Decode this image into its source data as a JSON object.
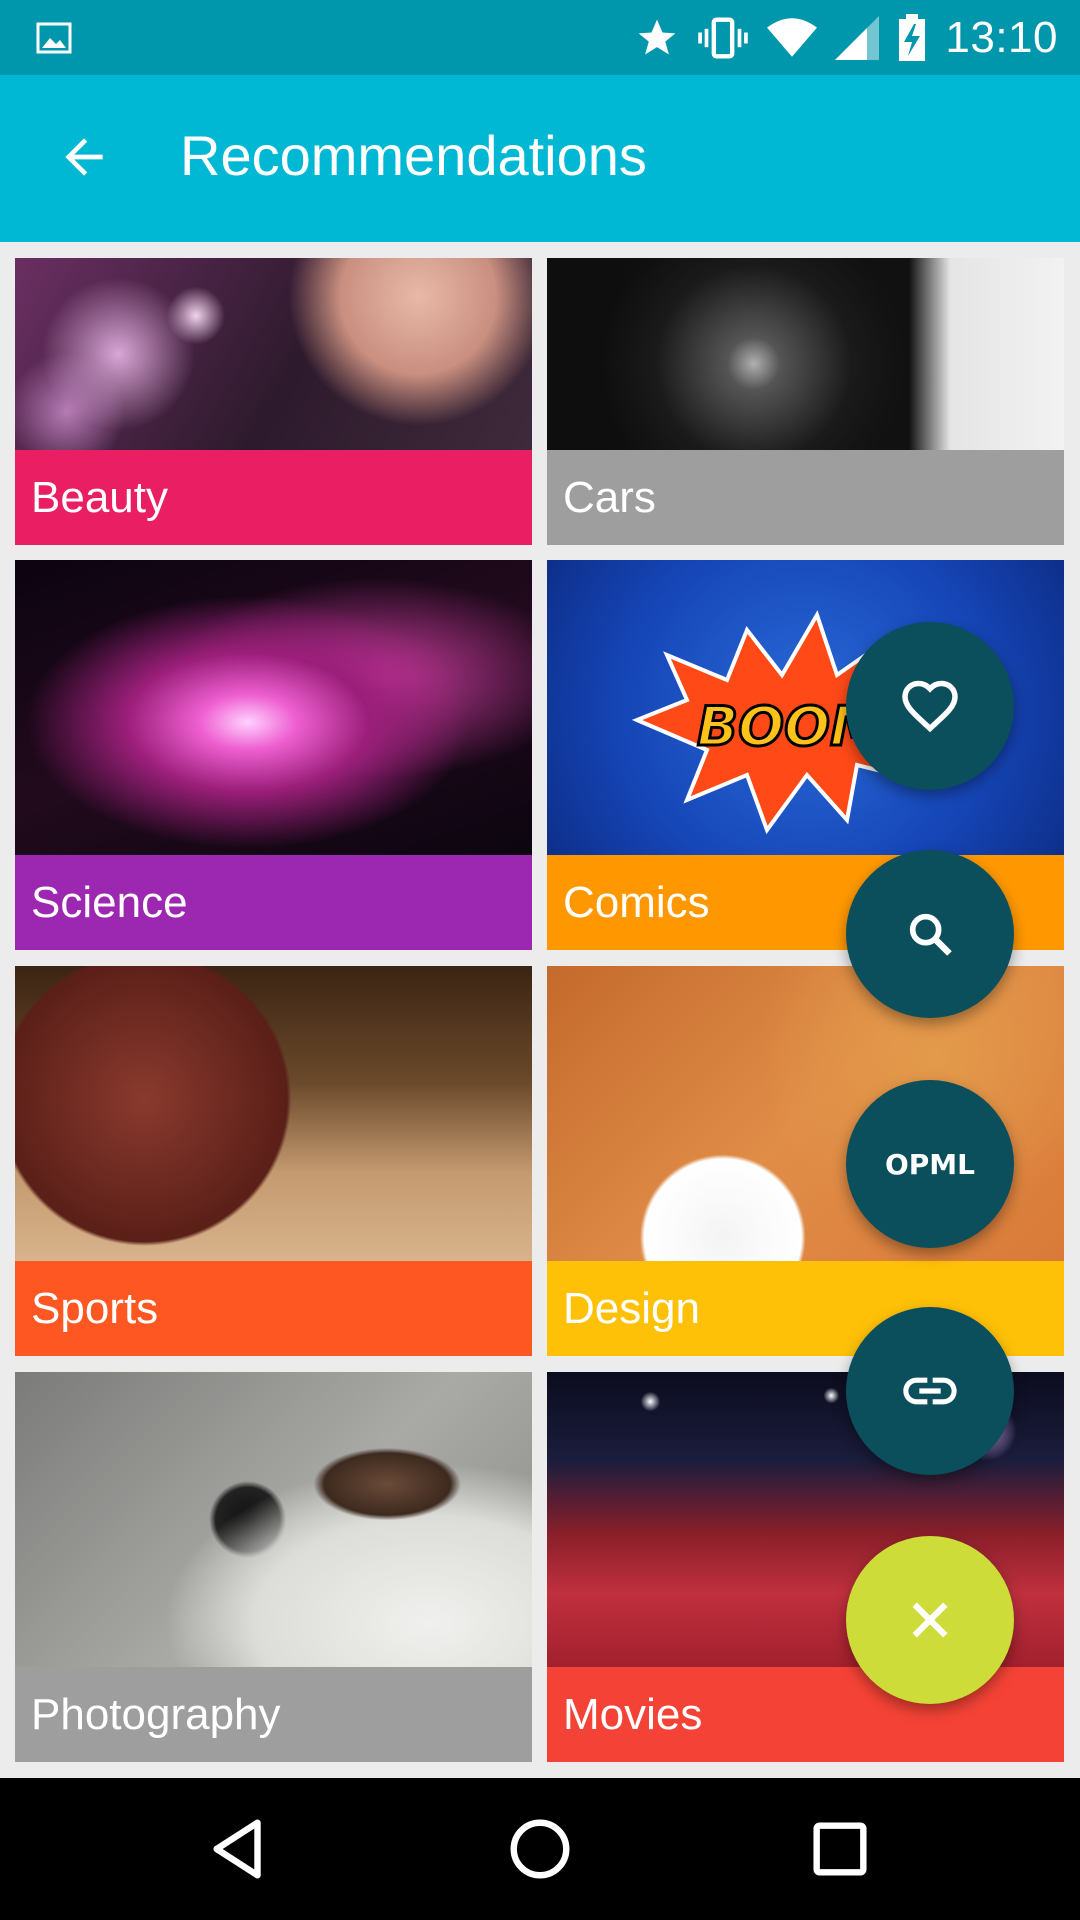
{
  "status_bar": {
    "time": "13:10",
    "icons": [
      "image-icon",
      "star-icon",
      "vibrate-icon",
      "wifi-icon",
      "signal-icon",
      "battery-charging-icon"
    ]
  },
  "app_bar": {
    "title": "Recommendations",
    "back_icon": "arrow-back-icon"
  },
  "categories": [
    {
      "label": "Beauty",
      "color": "#e91e63"
    },
    {
      "label": "Cars",
      "color": "#9e9e9e"
    },
    {
      "label": "Science",
      "color": "#9c27b0"
    },
    {
      "label": "Comics",
      "color": "#ff9800"
    },
    {
      "label": "Sports",
      "color": "#ff5722"
    },
    {
      "label": "Design",
      "color": "#ffc107"
    },
    {
      "label": "Photography",
      "color": "#9e9e9e"
    },
    {
      "label": "Movies",
      "color": "#f44336"
    }
  ],
  "fab_menu": {
    "items": [
      {
        "icon": "heart-icon"
      },
      {
        "icon": "search-icon"
      },
      {
        "icon": "opml-icon",
        "text": "OPML"
      },
      {
        "icon": "link-icon"
      },
      {
        "icon": "close-icon"
      }
    ],
    "color": "#0b4e5c",
    "close_color": "#cddc39"
  },
  "nav_bar": {
    "icons": [
      "back-triangle-icon",
      "home-circle-icon",
      "recents-square-icon"
    ]
  }
}
